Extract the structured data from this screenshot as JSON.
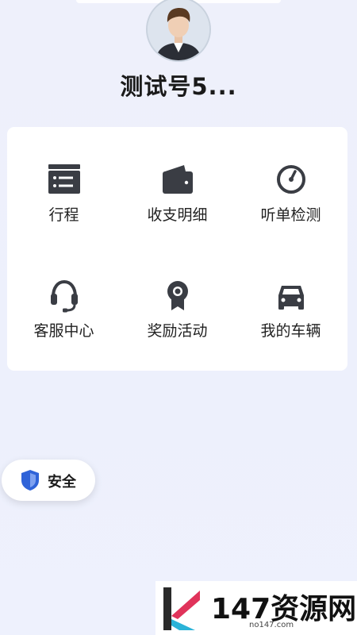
{
  "profile": {
    "name": "测试号5...",
    "avatar_icon": "user-avatar-icon"
  },
  "menu": {
    "items": [
      {
        "label": "行程",
        "icon": "itinerary-icon"
      },
      {
        "label": "收支明细",
        "icon": "wallet-icon"
      },
      {
        "label": "听单检测",
        "icon": "gauge-icon"
      },
      {
        "label": "客服中心",
        "icon": "headset-icon"
      },
      {
        "label": "奖励活动",
        "icon": "award-icon"
      },
      {
        "label": "我的车辆",
        "icon": "car-icon"
      }
    ]
  },
  "safety": {
    "label": "安全",
    "icon": "shield-icon",
    "color": "#2f63d8"
  },
  "watermark": {
    "brand": "147资源网",
    "site": "no147.com"
  },
  "colors": {
    "icon": "#3a3d44",
    "background": "#eef0fb"
  }
}
